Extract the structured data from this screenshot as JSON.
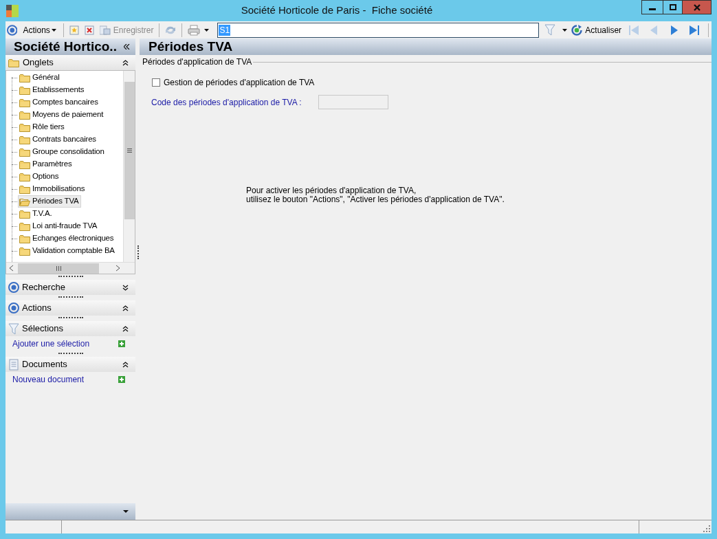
{
  "window": {
    "title": "Société Horticole de Paris -  Fiche société"
  },
  "toolbar": {
    "actions_label": "Actions",
    "save_label": "Enregistrer",
    "save_disabled": true,
    "search_value": "S1",
    "refresh_label": "Actualiser",
    "nav": [
      {
        "kind": "first",
        "disabled": true
      },
      {
        "kind": "prev",
        "disabled": true
      },
      {
        "kind": "next",
        "disabled": false
      },
      {
        "kind": "last",
        "disabled": false
      }
    ]
  },
  "sidebar": {
    "title": "Société Hortico..",
    "tabs_header": "Onglets",
    "items": [
      {
        "label": "Général",
        "selected": false
      },
      {
        "label": "Etablissements",
        "selected": false
      },
      {
        "label": "Comptes bancaires",
        "selected": false
      },
      {
        "label": "Moyens de paiement",
        "selected": false
      },
      {
        "label": "Rôle tiers",
        "selected": false
      },
      {
        "label": "Contrats bancaires",
        "selected": false
      },
      {
        "label": "Groupe consolidation",
        "selected": false
      },
      {
        "label": "Paramètres",
        "selected": false
      },
      {
        "label": "Options",
        "selected": false
      },
      {
        "label": "Immobilisations",
        "selected": false
      },
      {
        "label": "Périodes TVA",
        "selected": true
      },
      {
        "label": "T.V.A.",
        "selected": false
      },
      {
        "label": "Loi anti-fraude TVA",
        "selected": false
      },
      {
        "label": "Echanges électroniques",
        "selected": false
      },
      {
        "label": "Validation comptable BA",
        "selected": false
      }
    ],
    "panels": [
      {
        "kind": "target",
        "title": "Recherche",
        "expanded": false
      },
      {
        "kind": "target",
        "title": "Actions",
        "expanded": true
      },
      {
        "kind": "filter",
        "title": "Sélections",
        "expanded": true,
        "link": "Ajouter une sélection"
      },
      {
        "kind": "document",
        "title": "Documents",
        "expanded": true,
        "link": "Nouveau document"
      }
    ]
  },
  "content": {
    "title": "Périodes TVA",
    "group_title": "Périodes d'application de TVA",
    "checkbox": {
      "label": "Gestion de périodes d'application de TVA",
      "checked": false
    },
    "field_label": "Code des périodes d'application de TVA :",
    "message": [
      "Pour activer les périodes d'application de TVA,",
      "utilisez le bouton \"Actions\", \"Activer les périodes d'application de TVA\"."
    ]
  }
}
